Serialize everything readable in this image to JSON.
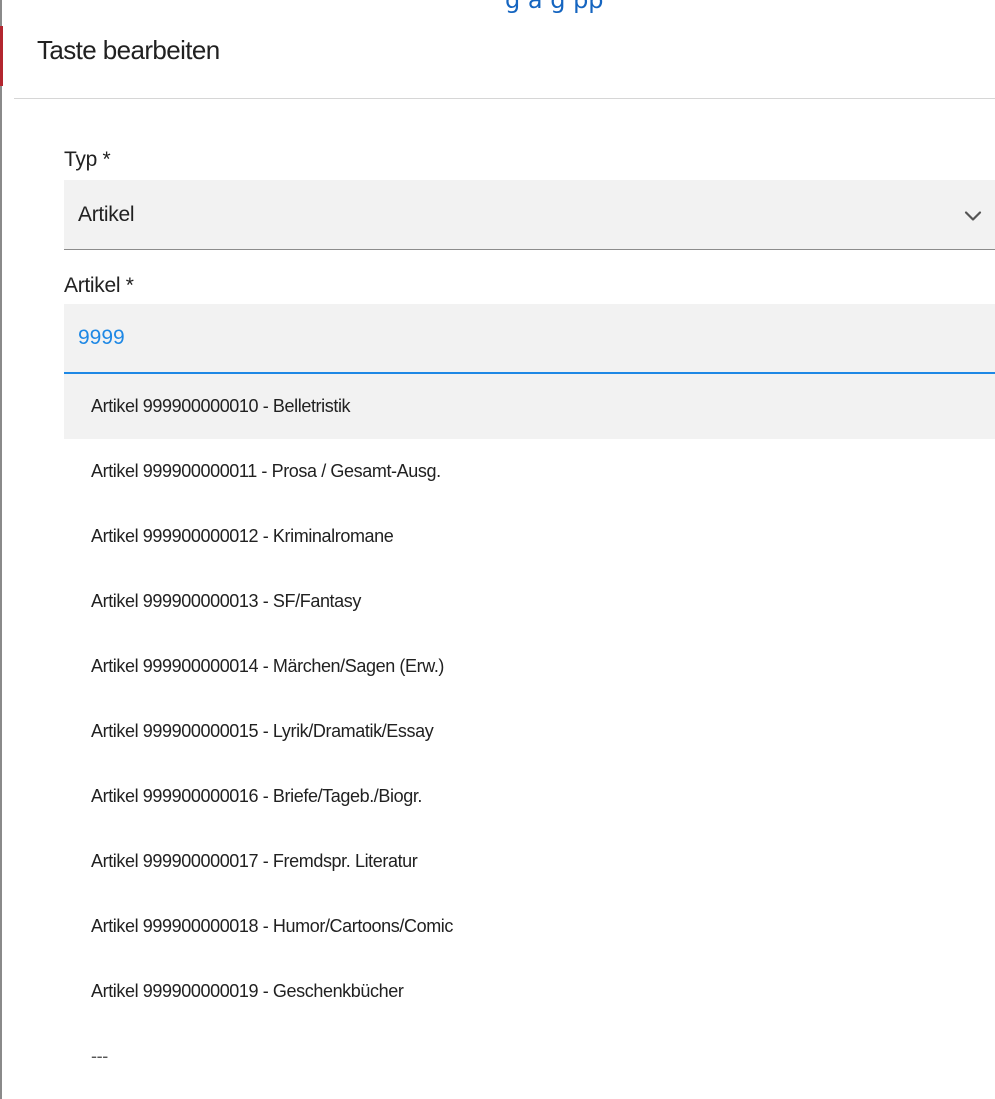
{
  "dialog": {
    "top_fragment": "g a   g  pp",
    "title": "Taste bearbeiten"
  },
  "form": {
    "typ": {
      "label": "Typ *",
      "value": "Artikel"
    },
    "artikel": {
      "label": "Artikel *",
      "value": "9999"
    }
  },
  "dropdown": {
    "options": [
      "Artikel 999900000010 - Belletristik",
      "Artikel 999900000011 - Prosa / Gesamt-Ausg.",
      "Artikel 999900000012 - Kriminalromane",
      "Artikel 999900000013 - SF/Fantasy",
      "Artikel 999900000014 - Märchen/Sagen (Erw.)",
      "Artikel 999900000015 - Lyrik/Dramatik/Essay",
      "Artikel 999900000016 - Briefe/Tageb./Biogr.",
      "Artikel 999900000017 - Fremdspr. Literatur",
      "Artikel 999900000018 - Humor/Cartoons/Comic",
      "Artikel 999900000019 - Geschenkbücher",
      "---"
    ],
    "highlighted_index": 0
  },
  "colors": {
    "accent": "#1e88e5",
    "field_background": "#f2f2f2",
    "text": "#212121"
  },
  "icons": {
    "select_chevron": "chevron-down-icon"
  }
}
